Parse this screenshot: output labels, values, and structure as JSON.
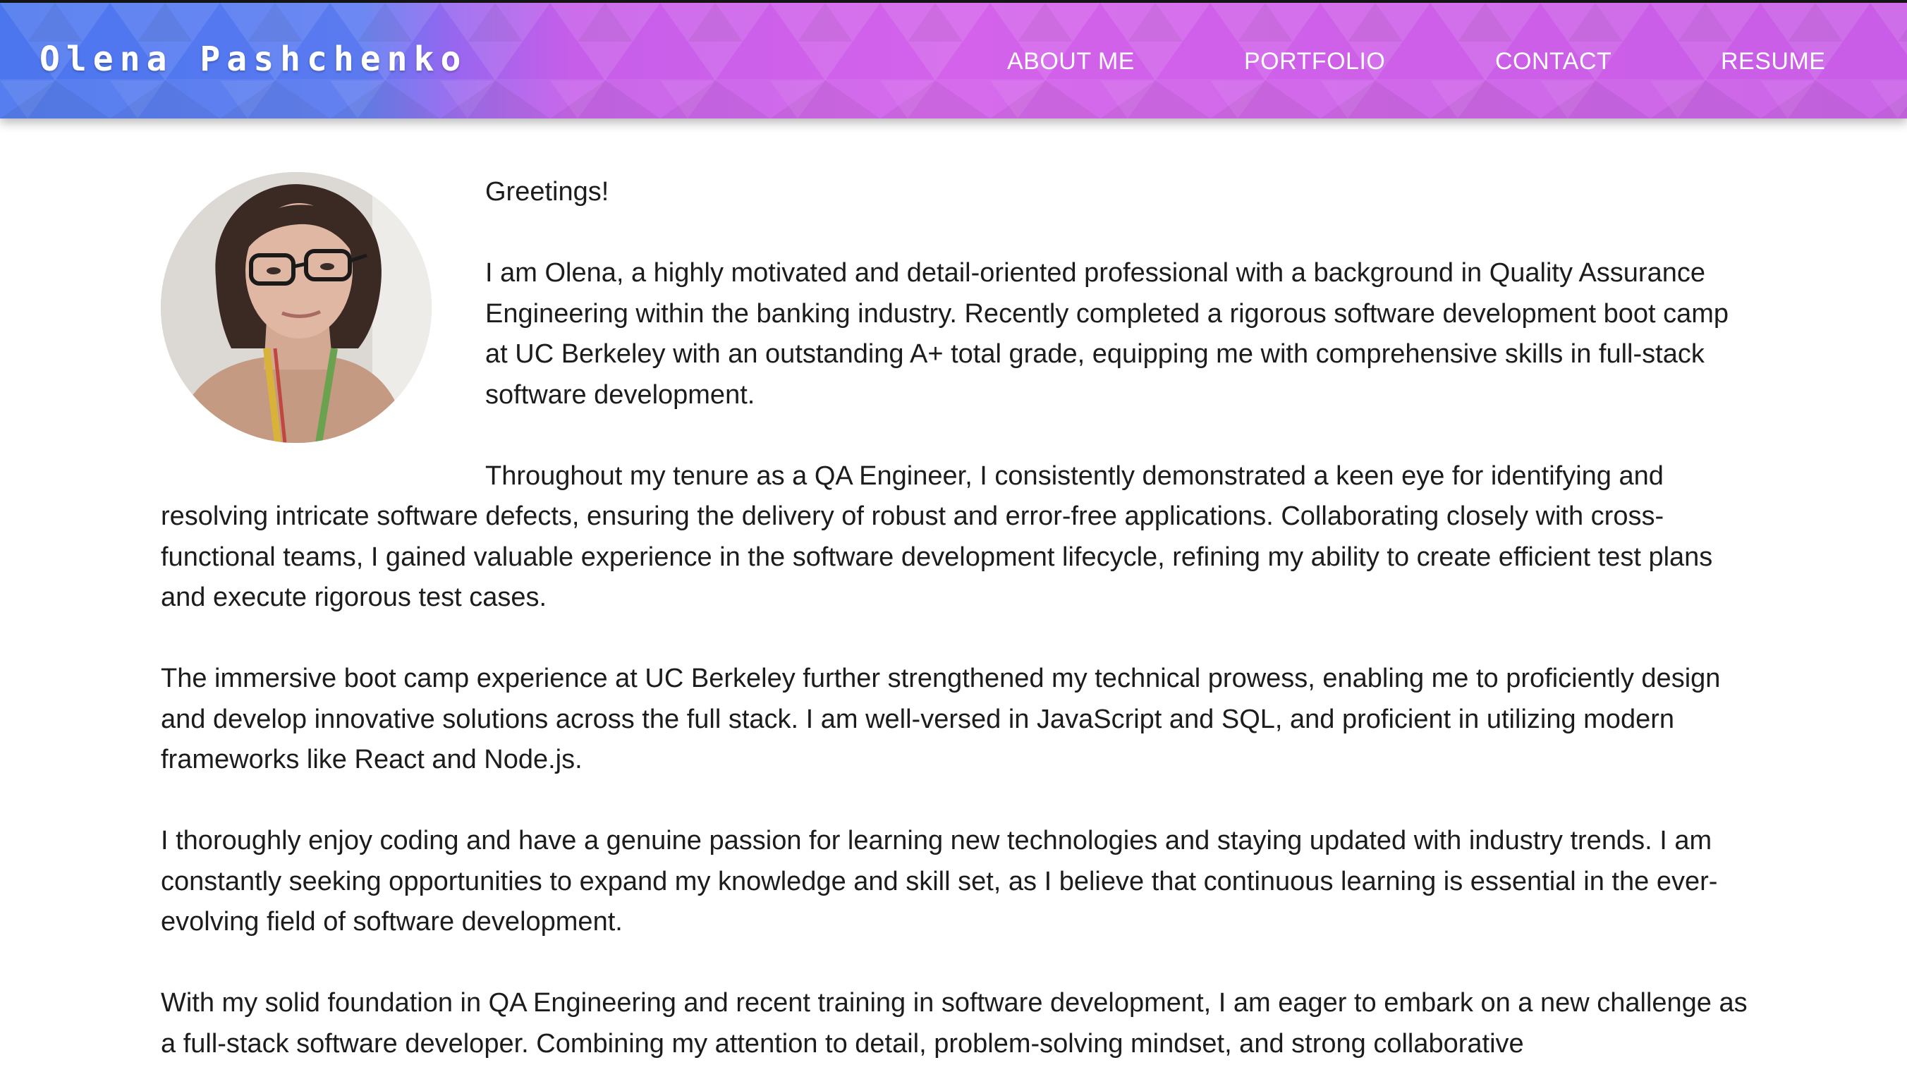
{
  "site": {
    "brand": "Olena Pashchenko"
  },
  "nav": {
    "about": "ABOUT ME",
    "portfolio": "PORTFOLIO",
    "contact": "CONTACT",
    "resume": "RESUME"
  },
  "about": {
    "greeting": "Greetings!",
    "paragraphs": [
      "I am Olena, a highly motivated and detail-oriented professional with a background in Quality Assurance Engineering within the banking industry. Recently completed a rigorous software development boot camp at UC Berkeley with an outstanding A+ total grade, equipping me with comprehensive skills in full-stack software development.",
      "Throughout my tenure as a QA Engineer, I consistently demonstrated a keen eye for identifying and resolving intricate software defects, ensuring the delivery of robust and error-free applications. Collaborating closely with cross-functional teams, I gained valuable experience in the software development lifecycle, refining my ability to create efficient test plans and execute rigorous test cases.",
      "The immersive boot camp experience at UC Berkeley further strengthened my technical prowess, enabling me to proficiently design and develop innovative solutions across the full stack. I am well-versed in JavaScript and SQL, and proficient in utilizing modern frameworks like React and Node.js.",
      "I thoroughly enjoy coding and have a genuine passion for learning new technologies and staying updated with industry trends. I am constantly seeking opportunities to expand my knowledge and skill set, as I believe that continuous learning is essential in the ever-evolving field of software development.",
      "With my solid foundation in QA Engineering and recent training in software development, I am eager to embark on a new challenge as a full-stack software developer. Combining my attention to detail, problem-solving mindset, and strong collaborative"
    ]
  },
  "colors": {
    "header_start": "#4c76ee",
    "header_end": "#c95de7",
    "text": "#1c1c1c",
    "background": "#ffffff"
  }
}
